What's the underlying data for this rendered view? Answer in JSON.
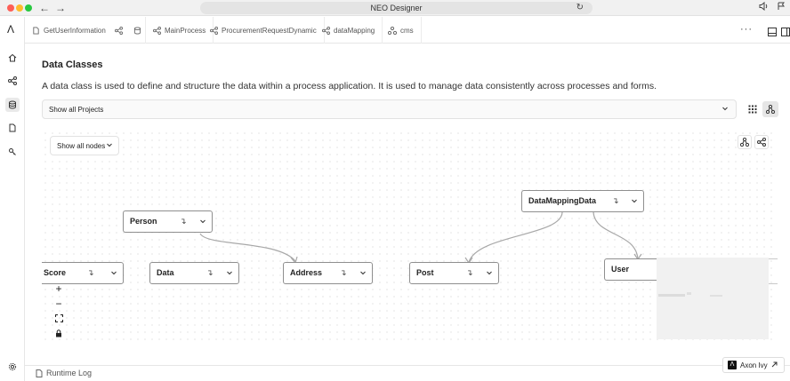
{
  "window": {
    "title": "NEO Designer"
  },
  "tabs": [
    {
      "label": "GetUserInformation",
      "icon": "data-class-icon"
    },
    {
      "label": "MainProcess",
      "icon": "process-icon"
    },
    {
      "label": "ProcurementRequestDynamic",
      "icon": "process-icon"
    },
    {
      "label": "dataMapping",
      "icon": "process-icon"
    },
    {
      "label": "cms",
      "icon": "cms-icon"
    }
  ],
  "main": {
    "title": "Data Classes",
    "description": "A data class is used to define and structure the data within a process application. It is used to manage data consistently across processes and forms.",
    "project_select": "Show all Projects"
  },
  "canvas": {
    "nodes_filter": "Show all nodes",
    "nodes": [
      {
        "id": "score",
        "label": "Score"
      },
      {
        "id": "data",
        "label": "Data"
      },
      {
        "id": "person",
        "label": "Person"
      },
      {
        "id": "address",
        "label": "Address"
      },
      {
        "id": "post",
        "label": "Post"
      },
      {
        "id": "datamappingdata",
        "label": "DataMappingData"
      },
      {
        "id": "user",
        "label": "User"
      }
    ],
    "edges": [
      {
        "from": "Person",
        "to": "Address"
      },
      {
        "from": "DataMappingData",
        "to": "Post"
      },
      {
        "from": "DataMappingData",
        "to": "User"
      }
    ]
  },
  "bottom": {
    "runtime_log": "Runtime Log",
    "brand": "Axon Ivy",
    "brand_logo": "Λ"
  },
  "rail": {
    "logo": "Λ"
  },
  "colors": {
    "accent": "#222222",
    "node_border": "#8f8f8f",
    "edge": "#a8a8a8"
  }
}
